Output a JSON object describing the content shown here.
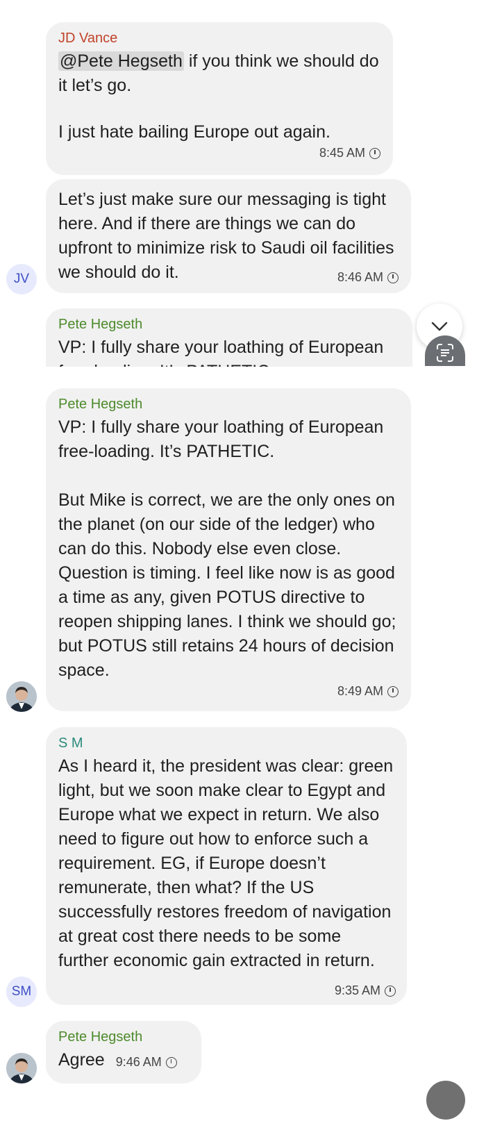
{
  "messages": [
    {
      "sender": "JD Vance",
      "mention": "@Pete Hegseth",
      "text_after_mention": " if you think we should do it let’s go.",
      "text2": "I just hate bailing Europe out again.",
      "time": "8:45 AM"
    },
    {
      "text": "Let’s just make sure our messaging is tight here. And if there are things we can do upfront to minimize risk to Saudi oil facilities we should do it.",
      "time": "8:46 AM",
      "avatar_initials": "JV"
    },
    {
      "sender": "Pete Hegseth",
      "text": "VP: I fully share your loathing of European free-loading. It’s PATHETIC."
    },
    {
      "sender": "Pete Hegseth",
      "text": "VP: I fully share your loathing of European free-loading. It’s PATHETIC.\n\nBut Mike is correct, we are the only ones on the planet (on our side of the ledger) who can do this. Nobody else even close. Question is timing. I feel like now is as good a time as any, given POTUS directive to reopen shipping lanes. I think we should go; but POTUS still retains 24 hours of decision space.",
      "time": "8:49 AM"
    },
    {
      "sender": "S M",
      "text": "As I heard it, the president was clear: green light, but we soon make clear to Egypt and Europe what we expect in return. We also need to figure out how to enforce such a requirement. EG, if Europe doesn’t remunerate, then what? If the US successfully restores freedom of navigation at great cost there needs to be some further economic gain extracted in return.",
      "time": "9:35 AM",
      "avatar_initials": "SM"
    },
    {
      "sender": "Pete Hegseth",
      "text": "Agree",
      "time": "9:46 AM"
    }
  ],
  "icons": {
    "scroll_down": "chevron-down-icon",
    "scan": "scan-text-icon",
    "clock": "clock-icon"
  },
  "colors": {
    "bubble": "#f1f1f1",
    "sender_jd": "#c0432a",
    "sender_pete": "#4d8a2c",
    "sender_sm": "#2c8a7b"
  }
}
